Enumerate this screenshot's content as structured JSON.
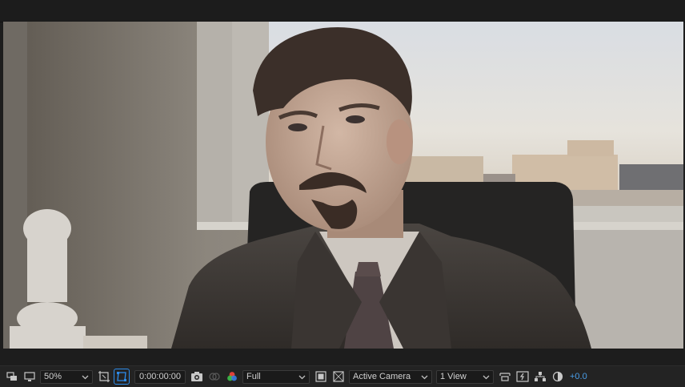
{
  "viewer": {
    "content": "composition-frame"
  },
  "toolbar": {
    "magnification": "50%",
    "timecode": "0:00:00:00",
    "resolution": "Full",
    "camera": "Active Camera",
    "views": "1 View",
    "exposure": "+0.0"
  },
  "icons": [
    "always-preview-icon",
    "monitor-icon",
    "region-of-interest-icon",
    "transparency-grid-icon",
    "snapshot-camera-icon",
    "show-snapshot-icon",
    "channel-rgb-icon",
    "fast-preview-icon",
    "toggle-mask-icon",
    "reset-view-icon",
    "timeline-icon",
    "comp-flowchart-icon",
    "exposure-reset-icon"
  ],
  "colors": {
    "accent": "#2d8ceb",
    "exposure_text": "#4a9ee8",
    "panel_bg": "#232323"
  }
}
